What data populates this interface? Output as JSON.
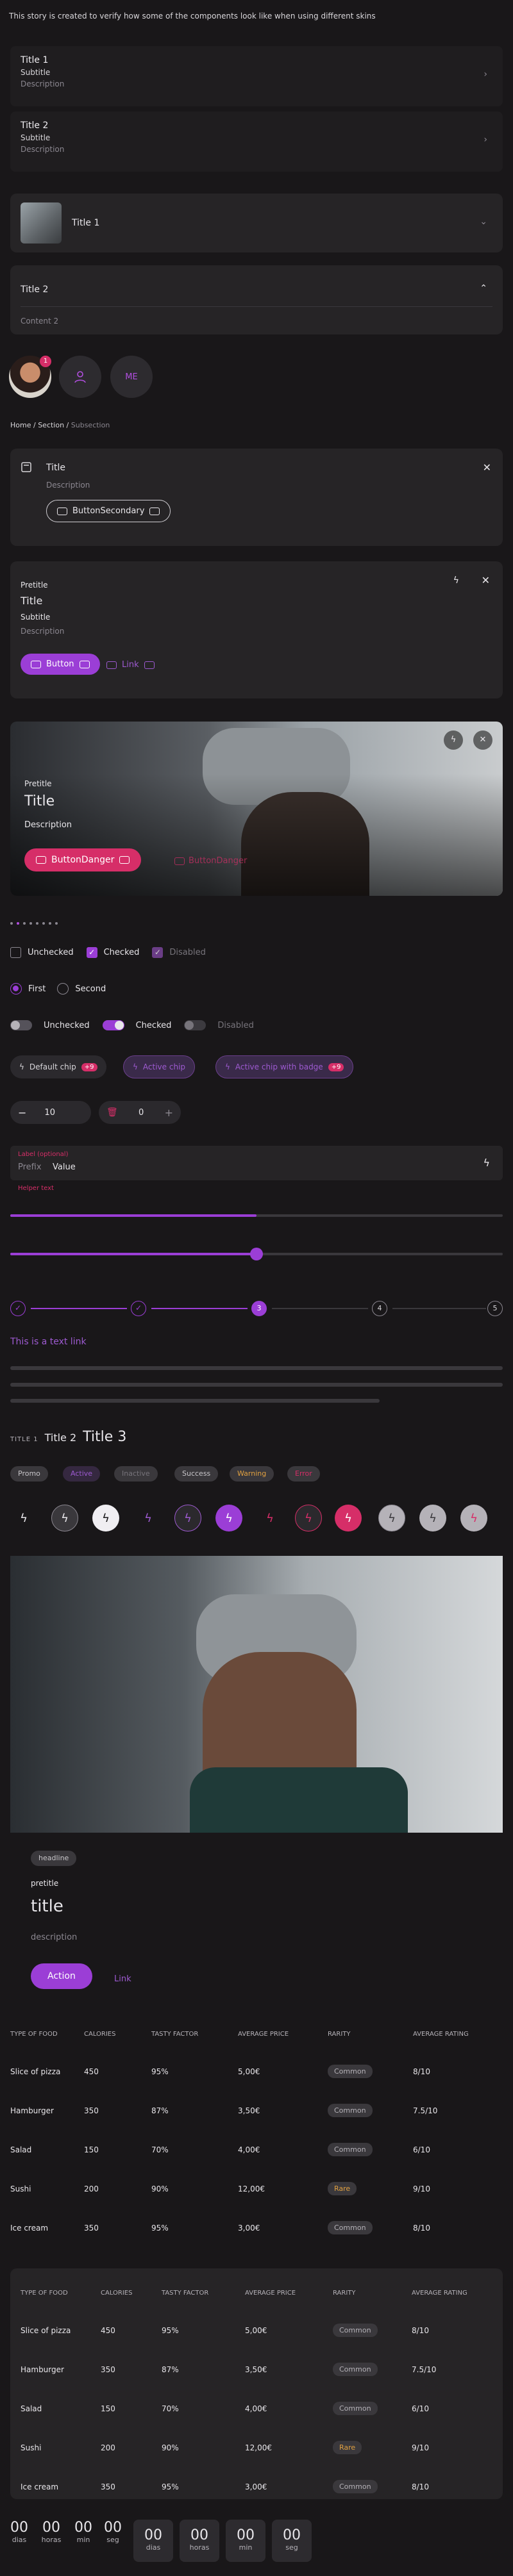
{
  "intro": "This story is created to verify how some of the components look like when using different skins",
  "rows": [
    {
      "title": "Title 1",
      "subtitle": "Subtitle",
      "description": "Description"
    },
    {
      "title": "Title 2",
      "subtitle": "Subtitle",
      "description": "Description"
    }
  ],
  "accordion": {
    "item1_title": "Title 1",
    "item2_title": "Title 2",
    "item2_content": "Content 2"
  },
  "avatars": {
    "badge": "1",
    "initials": "ME"
  },
  "breadcrumb": {
    "home": "Home",
    "section": "Section",
    "current": "Subsection"
  },
  "card1": {
    "title": "Title",
    "description": "Description",
    "button": "ButtonSecondary"
  },
  "card2": {
    "pretitle": "Pretitle",
    "title": "Title",
    "subtitle": "Subtitle",
    "description": "Description",
    "button": "Button",
    "link": "Link"
  },
  "hero": {
    "pretitle": "Pretitle",
    "title": "Title",
    "description": "Description",
    "button": "ButtonDanger",
    "link": "ButtonDanger"
  },
  "checkboxes": {
    "unchecked": "Unchecked",
    "checked": "Checked",
    "disabled": "Disabled"
  },
  "radios": {
    "first": "First",
    "second": "Second"
  },
  "switches": {
    "unchecked": "Unchecked",
    "checked": "Checked",
    "disabled": "Disabled"
  },
  "chips": {
    "default": "Default chip",
    "default_badge": "+9",
    "active": "Active chip",
    "active_badge": "Active chip with badge",
    "active_badge_count": "+9"
  },
  "steppers": {
    "stepper1": "10",
    "stepper2": "0"
  },
  "field": {
    "label": "Label (optional)",
    "prefix": "Prefix",
    "value": "Value",
    "helper": "Helper text"
  },
  "progress": {
    "value": 0.5
  },
  "slider": {
    "value": 0.5
  },
  "steps": {
    "current": "3",
    "s4": "4",
    "s5": "5"
  },
  "textlink": "This is a text link",
  "titles": {
    "t1": "TITLE 1",
    "t2": "Title 2",
    "t3": "Title 3"
  },
  "tags": [
    "Promo",
    "Active",
    "Inactive",
    "Success",
    "Warning",
    "Error"
  ],
  "media": {
    "headline": "headline",
    "pretitle": "pretitle",
    "title": "title",
    "description": "description",
    "action": "Action",
    "link": "Link"
  },
  "table": {
    "headers": [
      "TYPE OF FOOD",
      "CALORIES",
      "TASTY FACTOR",
      "AVERAGE PRICE",
      "RARITY",
      "AVERAGE RATING"
    ],
    "rows": [
      [
        "Slice of pizza",
        "450",
        "95%",
        "5,00€",
        "Common",
        "8/10"
      ],
      [
        "Hamburger",
        "350",
        "87%",
        "3,50€",
        "Common",
        "7.5/10"
      ],
      [
        "Salad",
        "150",
        "70%",
        "4,00€",
        "Common",
        "6/10"
      ],
      [
        "Sushi",
        "200",
        "90%",
        "12,00€",
        "Rare",
        "9/10"
      ],
      [
        "Ice cream",
        "350",
        "95%",
        "3,00€",
        "Common",
        "8/10"
      ]
    ]
  },
  "countdown": {
    "value": "00",
    "labels": [
      "dias",
      "horas",
      "min",
      "seg"
    ]
  },
  "colors": {
    "accent": "#9b3ed6",
    "danger": "#d62e68",
    "background": "#191719"
  }
}
